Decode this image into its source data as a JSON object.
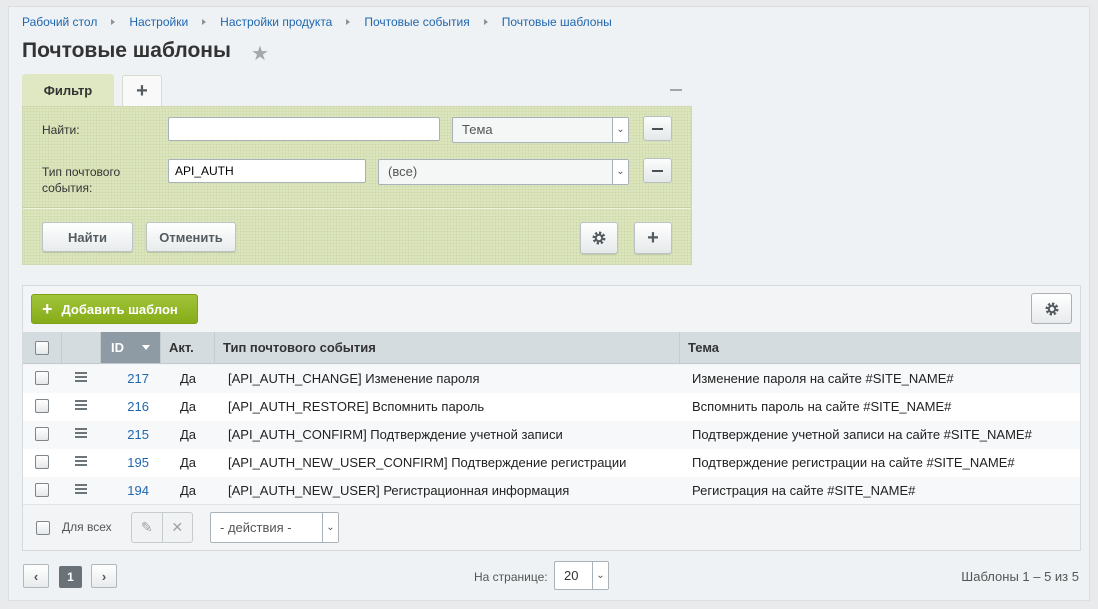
{
  "breadcrumb": [
    "Рабочий стол",
    "Настройки",
    "Настройки продукта",
    "Почтовые события",
    "Почтовые шаблоны"
  ],
  "page_title": "Почтовые шаблоны",
  "filter": {
    "tab_label": "Фильтр",
    "find_label": "Найти:",
    "find_value": "",
    "find_scope": "Тема",
    "event_type_label_1": "Тип почтового",
    "event_type_label_2": "события:",
    "event_type_value": "API_AUTH",
    "event_type_select": "(все)",
    "find_button": "Найти",
    "cancel_button": "Отменить"
  },
  "grid": {
    "add_button": "Добавить шаблон",
    "columns": {
      "id": "ID",
      "active": "Акт.",
      "event_type": "Тип почтового события",
      "subject": "Тема"
    },
    "rows": [
      {
        "id": "217",
        "active": "Да",
        "event_type": "[API_AUTH_CHANGE] Изменение пароля",
        "subject": "Изменение пароля на сайте #SITE_NAME#"
      },
      {
        "id": "216",
        "active": "Да",
        "event_type": "[API_AUTH_RESTORE] Вспомнить пароль",
        "subject": "Вспомнить пароль на сайте #SITE_NAME#"
      },
      {
        "id": "215",
        "active": "Да",
        "event_type": "[API_AUTH_CONFIRM] Подтверждение учетной записи",
        "subject": "Подтверждение учетной записи на сайте #SITE_NAME#"
      },
      {
        "id": "195",
        "active": "Да",
        "event_type": "[API_AUTH_NEW_USER_CONFIRM] Подтверждение регистрации",
        "subject": "Подтверждение регистрации на сайте #SITE_NAME#"
      },
      {
        "id": "194",
        "active": "Да",
        "event_type": "[API_AUTH_NEW_USER] Регистрационная информация",
        "subject": "Регистрация на сайте #SITE_NAME#"
      }
    ],
    "for_all_label": "Для всех",
    "actions_select": "- действия -"
  },
  "pager": {
    "current_page": "1",
    "per_page_label": "На странице:",
    "per_page_value": "20",
    "summary": "Шаблоны 1 – 5 из 5"
  }
}
